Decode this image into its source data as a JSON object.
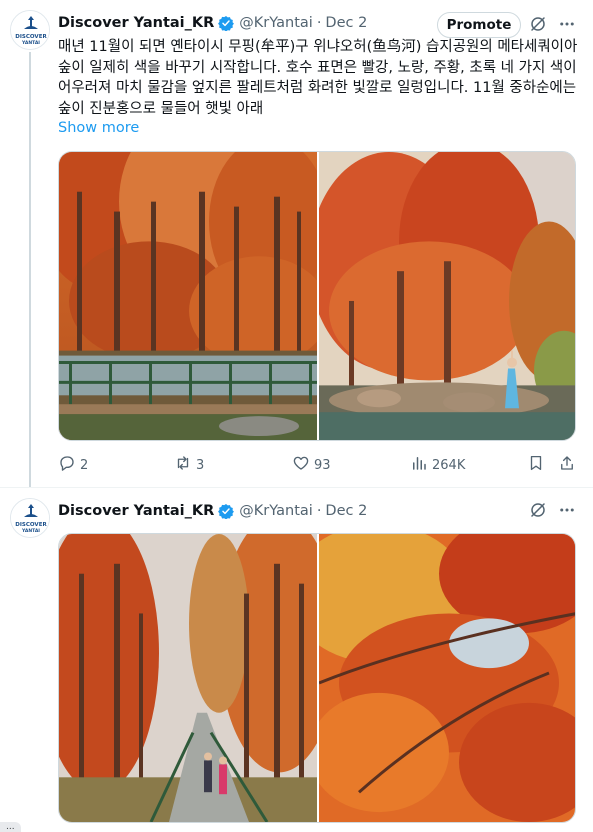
{
  "tweets": [
    {
      "avatar_text_top": "DISCOVER",
      "avatar_text_bottom": "YANTAI",
      "name": "Discover Yantai_KR",
      "handle": "@KrYantai",
      "separator": "·",
      "date": "Dec 2",
      "promote_label": "Promote",
      "text": "매년 11월이 되면 옌타이시 무핑(牟平)구 위냐오허(鱼鸟河) 습지공원의 메타세쿼이아 숲이 일제히 색을 바꾸기 시작합니다. 호수 표면은 빨강, 노랑, 주황, 초록 네 가지 색이 어우러져 마치 물감을 엎지른 팔레트처럼 화려한 빛깔로 일렁입니다. 11월 중하순에는 숲이 진분홍으로 물들어 햇빛 아래",
      "show_more": "Show more",
      "replies": "2",
      "reposts": "3",
      "likes": "93",
      "views": "264K"
    },
    {
      "avatar_text_top": "DISCOVER",
      "avatar_text_bottom": "YANTAI",
      "name": "Discover Yantai_KR",
      "handle": "@KrYantai",
      "separator": "·",
      "date": "Dec 2"
    }
  ],
  "status_url": "...",
  "icons": {
    "verified": "verified-badge-icon",
    "grok": "grok-icon",
    "more": "more-dots-icon",
    "reply": "reply-icon",
    "repost": "repost-icon",
    "like": "heart-icon",
    "views": "views-chart-icon",
    "bookmark": "bookmark-icon",
    "share": "share-icon"
  },
  "colors": {
    "accent": "#1d9bf0",
    "text": "#0f1419",
    "muted": "#536471",
    "border": "#cfd9de",
    "autumn_red": "#c8461e",
    "autumn_orange": "#e07a2c"
  }
}
